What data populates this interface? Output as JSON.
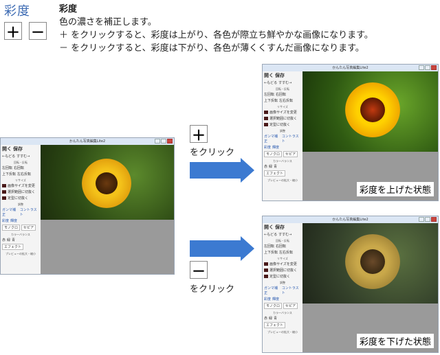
{
  "header": {
    "label": "彩度",
    "title": "彩度",
    "lines": [
      "色の濃さを補正します。",
      "＋ をクリックすると、彩度は上がり、各色が際立ち鮮やかな画像になります。",
      "－ をクリックすると、彩度は下がり、各色が薄くくすんだ画像になります。"
    ]
  },
  "buttons": {
    "plus": "＋",
    "minus": "－"
  },
  "window": {
    "title": "かんたん写真編集Lite2",
    "open": "開く",
    "save": "保存",
    "undo": "←もどる",
    "redo": "すすむ→",
    "rotate_title": "回転・反転",
    "rot_left": "左回転",
    "rot_right": "右回転",
    "flip_v": "上下反転",
    "flip_h": "左右反転",
    "resize_title": "リサイズ",
    "resize1": "画像サイズを変更",
    "resize2": "選択範囲に切抜く",
    "resize3": "定型に切抜く",
    "adjust_title": "調整",
    "gamma": "ガンマ補正",
    "contrast": "コントラスト",
    "saturation": "彩度",
    "brightness": "輝度",
    "mono": "モノクロ",
    "sepia": "セピア",
    "balance_title": "カラーバランス",
    "red": "赤",
    "green": "緑",
    "blue": "青",
    "effect": "エフェクト",
    "preview": "プレビューの拡大・縮小"
  },
  "click_plus": "をクリック",
  "click_minus": "をクリック",
  "result_up": "彩度を上げた状態",
  "result_down": "彩度を下げた状態"
}
